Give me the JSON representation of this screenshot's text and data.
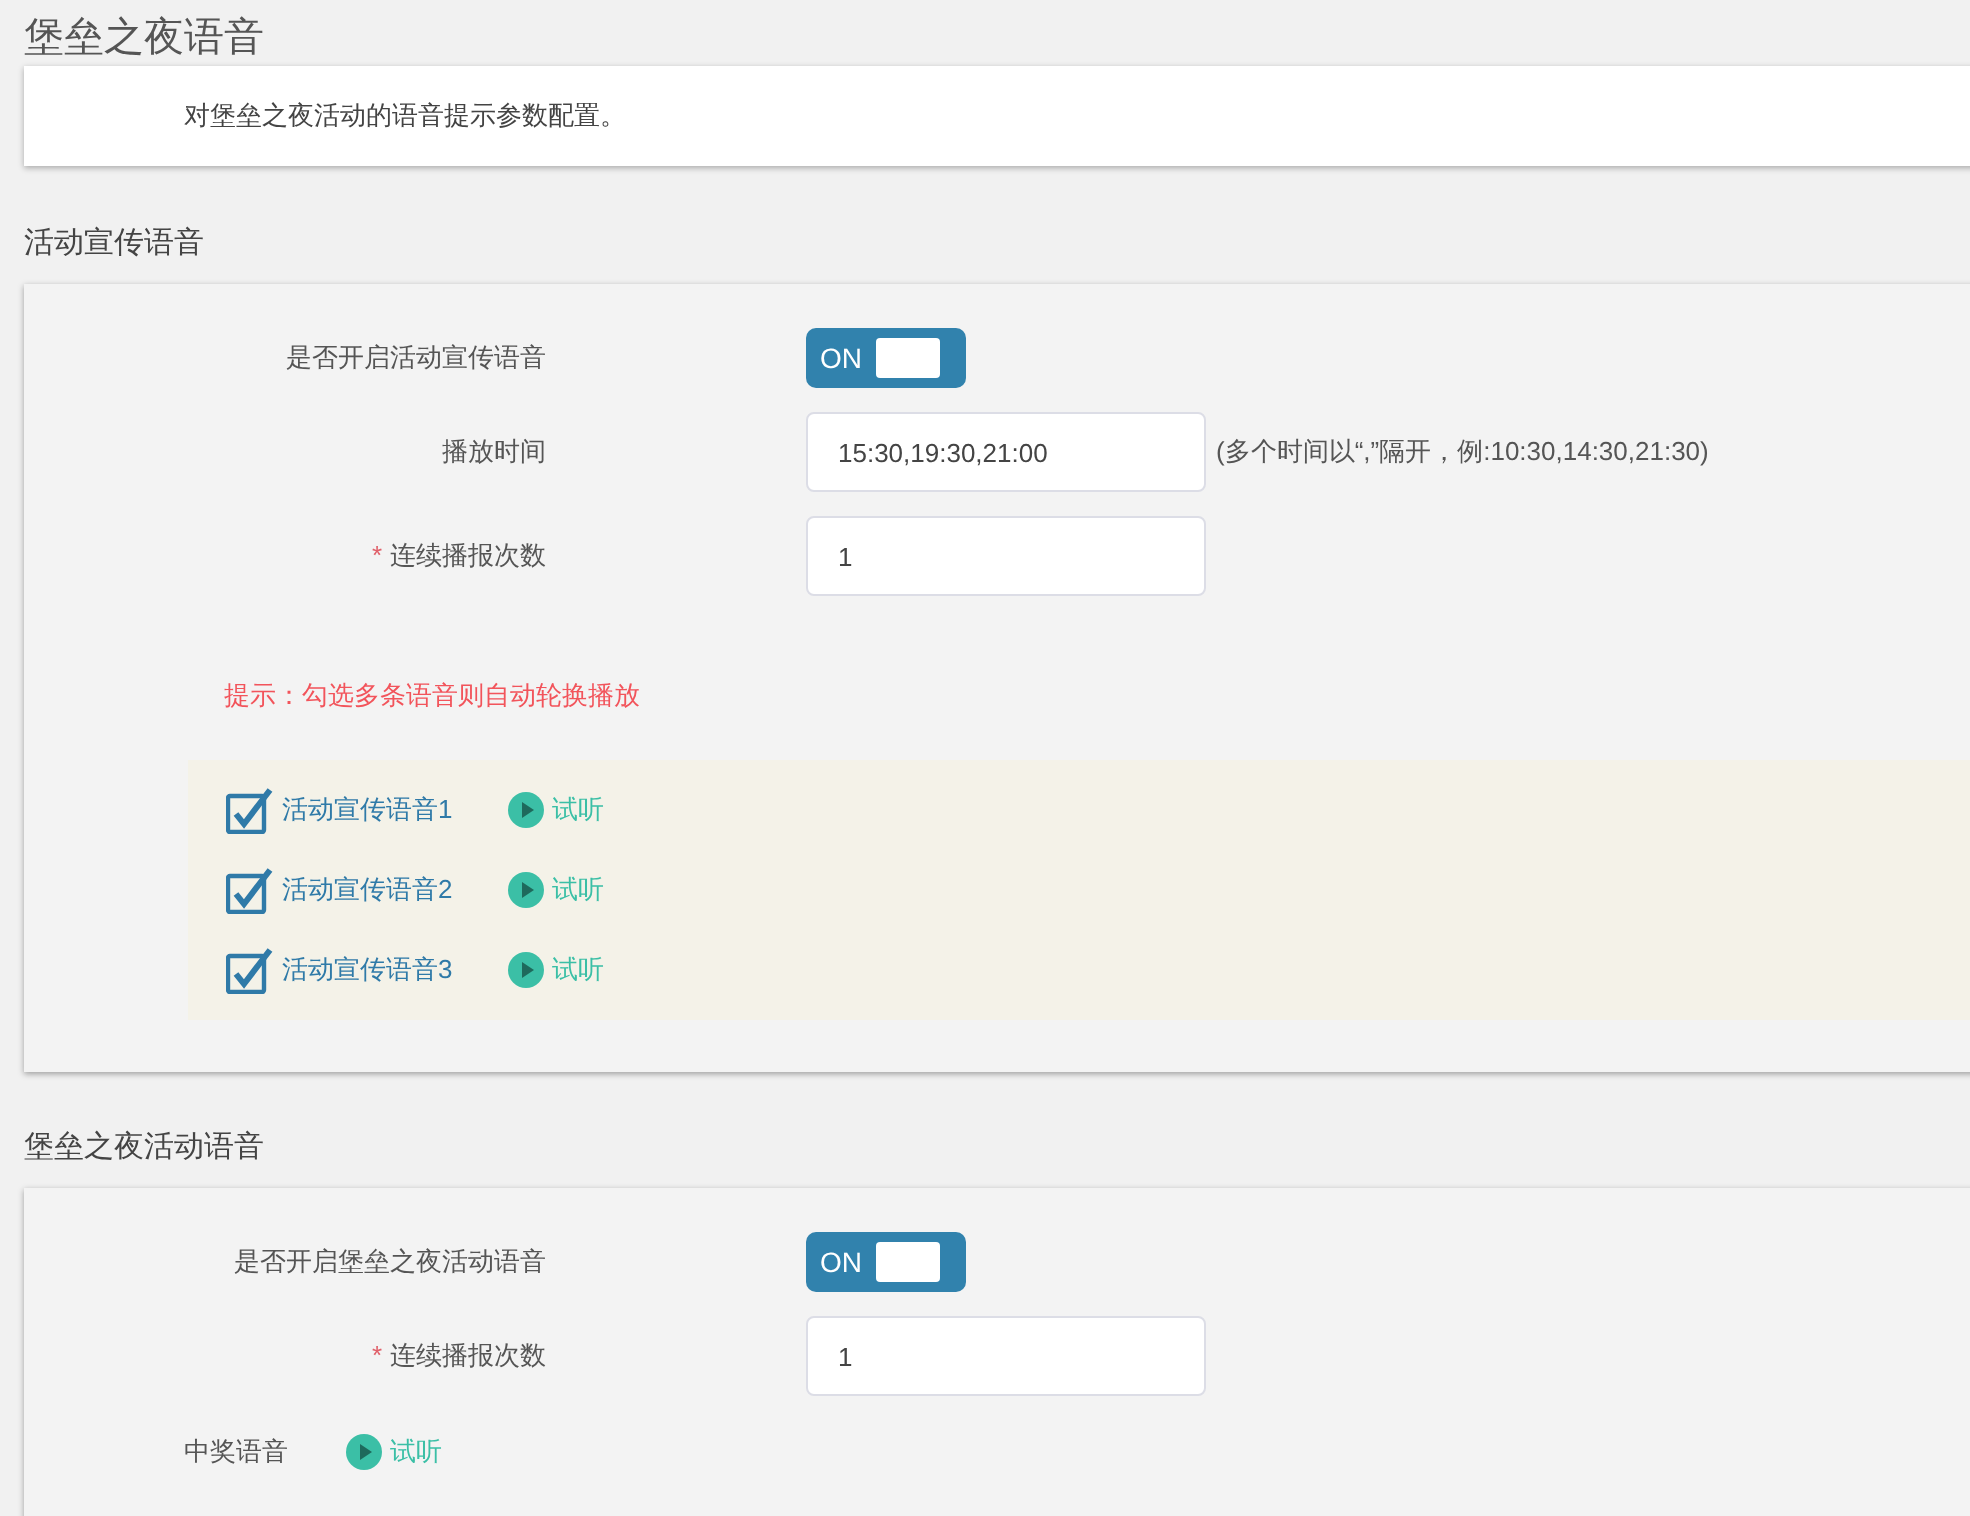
{
  "page": {
    "title": "堡垒之夜语音",
    "description": "对堡垒之夜活动的语音提示参数配置。"
  },
  "sections": [
    {
      "heading": "活动宣传语音",
      "fields": [
        {
          "kind": "toggle",
          "label": "是否开启活动宣传语音",
          "on": true,
          "on_text": "ON"
        },
        {
          "kind": "text",
          "label": "播放时间",
          "value": "15:30,19:30,21:00",
          "hint": "(多个时间以“,”隔开，例:10:30,14:30,21:30)"
        },
        {
          "kind": "text",
          "label": "连续播报次数",
          "required_mark": "*",
          "value": "1"
        }
      ],
      "tip": "提示：勾选多条语音则自动轮换播放",
      "voices": [
        {
          "label": "活动宣传语音1",
          "checked": true,
          "play": "试听"
        },
        {
          "label": "活动宣传语音2",
          "checked": true,
          "play": "试听"
        },
        {
          "label": "活动宣传语音3",
          "checked": true,
          "play": "试听"
        }
      ]
    },
    {
      "heading": "堡垒之夜活动语音",
      "fields": [
        {
          "kind": "toggle",
          "label": "是否开启堡垒之夜活动语音",
          "on": true,
          "on_text": "ON"
        },
        {
          "kind": "text",
          "label": "连续播报次数",
          "required_mark": "*",
          "value": "1"
        }
      ],
      "audio": {
        "label": "中奖语音",
        "play": "试听"
      }
    }
  ]
}
